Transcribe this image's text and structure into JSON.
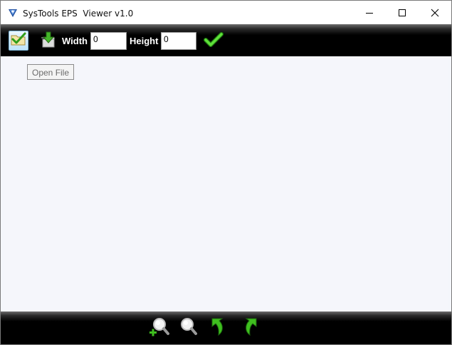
{
  "window": {
    "title": "SysTools EPS  Viewer v1.0",
    "app_icon": "systools-logo-icon",
    "controls": [
      "minimize-icon",
      "maximize-icon",
      "close-icon"
    ]
  },
  "toolbar": {
    "open_icon": "open-folder-check-icon",
    "save_icon": "save-download-icon",
    "width_label": "Width",
    "width_value": "0",
    "height_label": "Height",
    "height_value": "0",
    "apply_icon": "green-checkmark-icon"
  },
  "tooltip": {
    "text": "Open File"
  },
  "bottom_toolbar": {
    "icons": [
      "zoom-in-icon",
      "zoom-out-icon",
      "rotate-left-icon",
      "rotate-right-icon"
    ]
  },
  "colors": {
    "toolbar_bg": "#000000",
    "canvas_bg": "#f5f6fb",
    "accent_green": "#3fbf1f"
  }
}
